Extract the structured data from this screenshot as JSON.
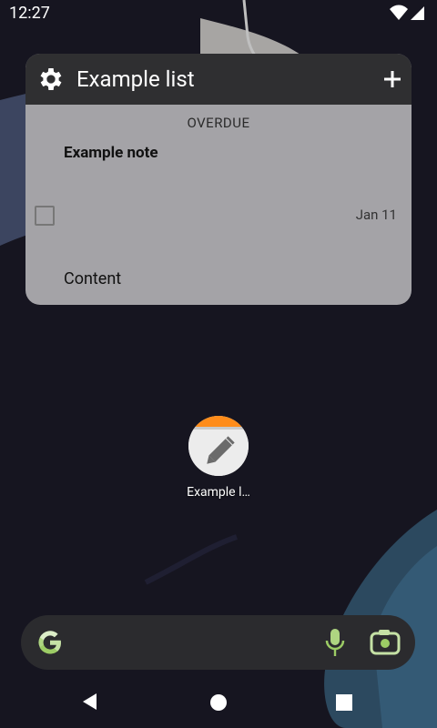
{
  "status": {
    "time": "12:27"
  },
  "widget": {
    "title": "Example list",
    "section": "OVERDUE",
    "note": {
      "title": "Example note",
      "date": "Jan 11",
      "content": "Content"
    }
  },
  "app": {
    "label": "Example l…"
  },
  "icons": {
    "settings": "gear-icon",
    "add": "plus-icon",
    "wifi": "wifi-icon",
    "signal": "signal-icon",
    "google": "google-g-icon",
    "mic": "mic-icon",
    "lens": "camera-lens-icon",
    "back": "back-triangle-icon",
    "home": "home-circle-icon",
    "recents": "recents-square-icon"
  },
  "colors": {
    "widget_header": "#2f2f31",
    "widget_body": "#a4a3a7",
    "app_icon_accent": "#ff8c1a",
    "search_bar": "#2b2b2e"
  }
}
